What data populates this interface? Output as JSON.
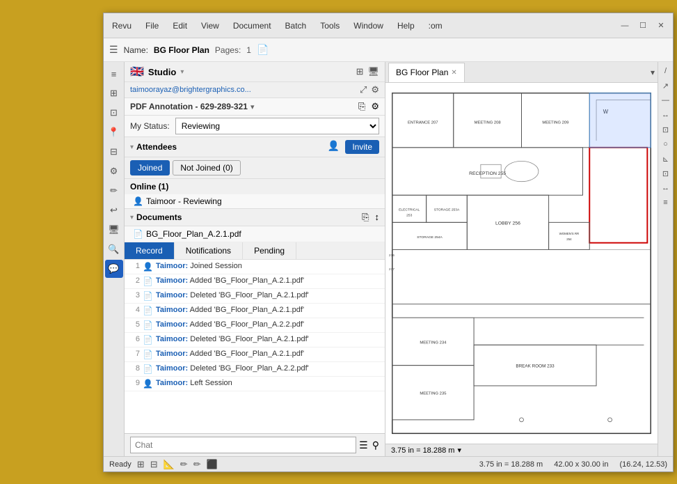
{
  "titleBar": {
    "menus": [
      "Revu",
      "File",
      "Edit",
      "View",
      "Document",
      "Batch",
      "Tools",
      "Window",
      "Help",
      ":om"
    ],
    "windowControls": [
      "—",
      "☐",
      "✕"
    ]
  },
  "toolbar": {
    "icon": "☰",
    "nameLabel": "Name:",
    "fileName": "BG Floor Plan",
    "pagesLabel": "Pages:",
    "pagesCount": "1",
    "pageIcon": "📄"
  },
  "studio": {
    "flag": "🇬🇧",
    "label": "Studio",
    "chevron": "▾",
    "gridIcon": "⊞",
    "monitorIcon": "🖥"
  },
  "emailBar": {
    "email": "taimoorayaz@brightergraphics.co...",
    "expandIcon": "⤢",
    "settingsIcon": "⚙"
  },
  "session": {
    "label": "PDF Annotation - 629-289-321",
    "chevron": "▾",
    "shareIcon": "⎘",
    "settingsIcon": "⚙"
  },
  "statusRow": {
    "label": "My Status:",
    "value": "Reviewing"
  },
  "attendees": {
    "label": "Attendees",
    "chevron": "▾",
    "personIcon": "👤",
    "addPersonIcon": "👤+",
    "inviteLabel": "Invite",
    "tabs": [
      {
        "label": "Joined",
        "active": true
      },
      {
        "label": "Not Joined (0)",
        "active": false
      }
    ],
    "onlineLabel": "Online (1)",
    "onlineItems": [
      {
        "icon": "👤",
        "name": "Taimoor - Reviewing"
      }
    ]
  },
  "documents": {
    "label": "Documents",
    "chevron": "▾",
    "copyIcon": "⎘",
    "sortIcon": "↕",
    "items": [
      {
        "icon": "📄",
        "name": "BG_Floor_Plan_A.2.1.pdf"
      }
    ]
  },
  "recordTabs": {
    "tabs": [
      {
        "label": "Record",
        "active": true
      },
      {
        "label": "Notifications",
        "active": false
      },
      {
        "label": "Pending",
        "active": false
      }
    ]
  },
  "recordItems": [
    {
      "num": "1",
      "icon": "👤",
      "name": "Taimoor:",
      "action": "Joined Session"
    },
    {
      "num": "2",
      "icon": "📄",
      "name": "Taimoor:",
      "action": "Added 'BG_Floor_Plan_A.2.1.pdf'"
    },
    {
      "num": "3",
      "icon": "📄",
      "name": "Taimoor:",
      "action": "Deleted 'BG_Floor_Plan_A.2.1.pdf'"
    },
    {
      "num": "4",
      "icon": "📄",
      "name": "Taimoor:",
      "action": "Added 'BG_Floor_Plan_A.2.1.pdf'"
    },
    {
      "num": "5",
      "icon": "📄",
      "name": "Taimoor:",
      "action": "Added 'BG_Floor_Plan_A.2.2.pdf'"
    },
    {
      "num": "6",
      "icon": "📄",
      "name": "Taimoor:",
      "action": "Deleted 'BG_Floor_Plan_A.2.1.pdf'"
    },
    {
      "num": "7",
      "icon": "📄",
      "name": "Taimoor:",
      "action": "Added 'BG_Floor_Plan_A.2.1.pdf'"
    },
    {
      "num": "8",
      "icon": "📄",
      "name": "Taimoor:",
      "action": "Deleted 'BG_Floor_Plan_A.2.2.pdf'"
    },
    {
      "num": "9",
      "icon": "👤",
      "name": "Taimoor:",
      "action": "Left Session"
    }
  ],
  "chat": {
    "placeholder": "Chat",
    "listIcon": "☰",
    "filterIcon": "⚲"
  },
  "docTabs": [
    {
      "label": "BG Floor Plan",
      "active": true
    }
  ],
  "statusBarLeft": {
    "readyLabel": "Ready"
  },
  "statusBarIcons": [
    "⊞",
    "⊟",
    "📐",
    "✏",
    "✏",
    "⬛"
  ],
  "statusBarMeasurements": {
    "scale": "3.75 in = 18.288 m",
    "dimensions": "42.00 x 30.00 in",
    "coordinates": "(16.24, 12.53)"
  },
  "docAreaScale": "3.75 in = 18.288 m",
  "leftSidebarIcons": [
    "≡",
    "⊞",
    "⊡",
    "📍",
    "⊟",
    "⚙",
    "✏",
    "↩",
    "🖥",
    "🔍",
    "💬"
  ],
  "rightSidebarIcons": [
    "/",
    "↗",
    "—",
    "↔",
    "⊡",
    "○",
    "⊾",
    "⊡",
    "↔",
    "≡"
  ],
  "floorPlan": {
    "rooms": [
      {
        "label": "ENTRANCE 207"
      },
      {
        "label": "MEETING 208"
      },
      {
        "label": "MEETING 209"
      },
      {
        "label": "RECEPTION 255"
      },
      {
        "label": "ELECTRICAL 253"
      },
      {
        "label": "STORAGE 253A"
      },
      {
        "label": "STORAGE 254A"
      },
      {
        "label": "LOBBY 256"
      },
      {
        "label": "WOMEN'S RR 254"
      },
      {
        "label": "MEETING 234"
      },
      {
        "label": "MEETING 235"
      },
      {
        "label": "BREAK ROOM 233"
      }
    ]
  }
}
